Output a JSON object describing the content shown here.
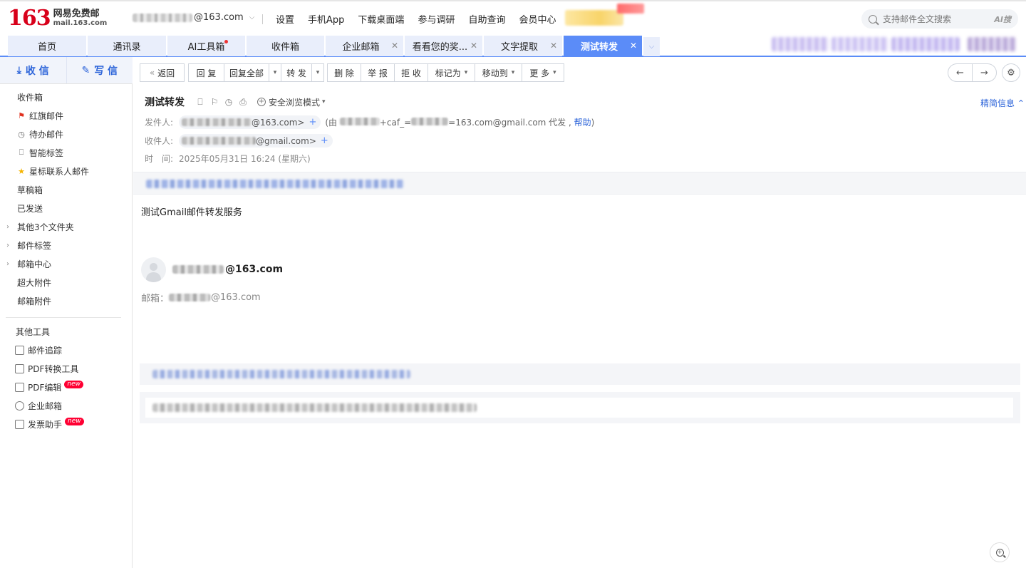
{
  "brand": {
    "logo_number": "163",
    "logo_cn": "网易免费邮",
    "logo_domain": "mail.163.com",
    "color": "#d8001a"
  },
  "account": {
    "email_suffix": "@163.com"
  },
  "top_nav": [
    "设置",
    "手机App",
    "下载桌面端",
    "参与调研",
    "自助查询",
    "会员中心"
  ],
  "search": {
    "placeholder": "支持邮件全文搜索",
    "ai_label": "AI搜"
  },
  "tabs": [
    {
      "label": "首页",
      "closable": false
    },
    {
      "label": "通讯录",
      "closable": false
    },
    {
      "label": "AI工具箱",
      "closable": false,
      "dot": true
    },
    {
      "label": "收件箱",
      "closable": false
    },
    {
      "label": "企业邮箱",
      "closable": true
    },
    {
      "label": "看看您的奖...",
      "closable": true
    },
    {
      "label": "文字提取",
      "closable": true
    },
    {
      "label": "测试转发",
      "closable": true,
      "active": true
    }
  ],
  "compose": {
    "receive": "收 信",
    "write": "写 信"
  },
  "sidebar": {
    "items": [
      {
        "label": "收件箱"
      },
      {
        "label": "红旗邮件",
        "icon": "flag-icon"
      },
      {
        "label": "待办邮件",
        "icon": "clock-icon"
      },
      {
        "label": "智能标签",
        "icon": "bookmark-icon"
      },
      {
        "label": "星标联系人邮件",
        "icon": "star-icon"
      },
      {
        "label": "草稿箱"
      },
      {
        "label": "已发送"
      },
      {
        "label": "其他3个文件夹",
        "expandable": true
      },
      {
        "label": "邮件标签",
        "expandable": true
      },
      {
        "label": "邮箱中心",
        "expandable": true
      },
      {
        "label": "超大附件"
      },
      {
        "label": "邮箱附件"
      }
    ],
    "tools_title": "其他工具",
    "tools": [
      {
        "label": "邮件追踪",
        "icon": "envelope-icon"
      },
      {
        "label": "PDF转换工具",
        "icon": "pdf-icon"
      },
      {
        "label": "PDF编辑",
        "icon": "pdf-edit-icon",
        "badge": "new"
      },
      {
        "label": "企业邮箱",
        "icon": "globe-icon"
      },
      {
        "label": "发票助手",
        "icon": "invoice-icon",
        "badge": "new"
      }
    ]
  },
  "toolbar": {
    "back": "返回",
    "reply": "回 复",
    "reply_all": "回复全部",
    "forward": "转 发",
    "delete": "删 除",
    "report": "举 报",
    "reject": "拒 收",
    "mark_as": "标记为",
    "move_to": "移动到",
    "more": "更 多"
  },
  "mail": {
    "subject": "测试转发",
    "safe_mode": "安全浏览模式",
    "brief_info": "精简信息",
    "from_label": "发件人:",
    "from_suffix": "@163.com>",
    "via_prefix": "(由",
    "via_mid": "+caf_=",
    "via_suffix": "=163.com@gmail.com 代发 ,",
    "via_help": "帮助",
    "via_close": ")",
    "to_label": "收件人:",
    "to_suffix": "@gmail.com>",
    "time_label": "时　间:",
    "time_value": "2025年05月31日 16:24 (星期六)",
    "body_text": "测试Gmail邮件转发服务",
    "signature_name_suffix": "@163.com",
    "signature_mail_label": "邮箱：",
    "signature_mail_suffix": "@163.com"
  }
}
